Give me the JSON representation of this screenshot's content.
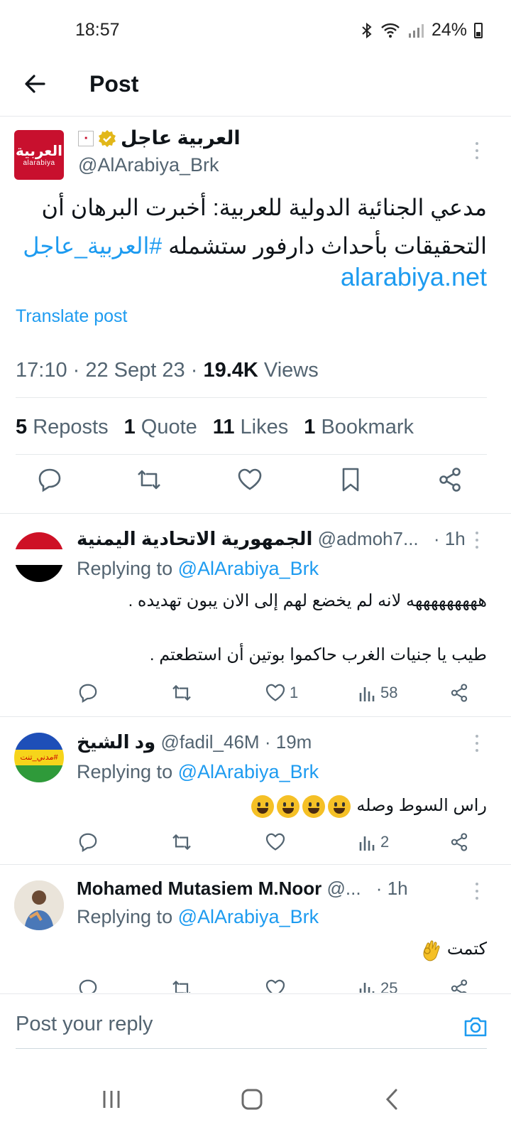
{
  "status": {
    "time": "18:57",
    "battery": "24%"
  },
  "header": {
    "title": "Post"
  },
  "post": {
    "author_name": "العربية عاجل",
    "avatar_text_ar": "العربية",
    "avatar_text_en": "alarabiya",
    "handle": "@AlArabiya_Brk",
    "text_line1": "مدعي الجنائية الدولية للعربية: أخبرت البرهان أن",
    "text_line2": "التحقيقات بأحداث دارفور ستشمله ",
    "hashtag": "#العربية_عاجل",
    "link": "alarabiya.net",
    "translate": "Translate post",
    "time": "17:10",
    "date": "22 Sept 23",
    "views_count": "19.4K",
    "views_label": "Views",
    "reposts_count": "5",
    "reposts_label": "Reposts",
    "quote_count": "1",
    "quote_label": "Quote",
    "likes_count": "11",
    "likes_label": "Likes",
    "bookmark_count": "1",
    "bookmark_label": "Bookmark"
  },
  "replies": [
    {
      "name": "الجمهورية الاتحادية اليمنية",
      "handle": "@admoh7...",
      "time": "1h",
      "replying_prefix": "Replying to",
      "replying_to": "@AlArabiya_Brk",
      "text_line1": "هههههههههه لانه لم يخضع لهم إلى الان يبون تهديده .",
      "text_line2": "طيب يا جنيات الغرب حاكموا بوتين أن استطعتم .",
      "likes": "1",
      "views": "58"
    },
    {
      "name": "ود الشيخ",
      "handle": "@fadil_46M",
      "time": "19m",
      "replying_prefix": "Replying to",
      "replying_to": "@AlArabiya_Brk",
      "text_line1": "راس السوط وصله",
      "avatar_text": "#مدني_تنت",
      "likes": "",
      "views": "2"
    },
    {
      "name": "Mohamed Mutasiem M.Noor",
      "handle": "@...",
      "time": "1h",
      "replying_prefix": "Replying to",
      "replying_to": "@AlArabiya_Brk",
      "text_line1": "كتمت",
      "likes": "",
      "views": "25"
    }
  ],
  "reply_bar": {
    "placeholder": "Post your reply"
  }
}
